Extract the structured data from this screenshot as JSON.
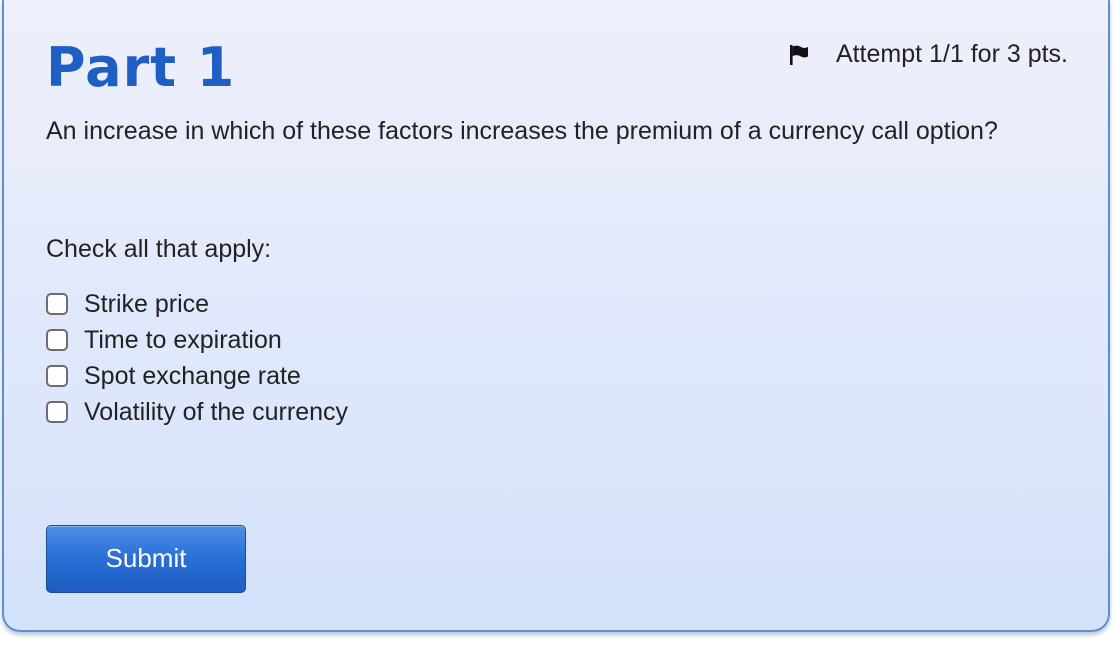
{
  "part": {
    "title": "Part 1"
  },
  "attempt": {
    "icon": "flag-icon",
    "text": "Attempt 1/1 for 3 pts."
  },
  "question": {
    "text": "An increase in which of these factors increases the premium of a currency call option?"
  },
  "instruction": "Check all that apply:",
  "options": [
    {
      "label": "Strike price",
      "checked": false
    },
    {
      "label": "Time to expiration",
      "checked": false
    },
    {
      "label": "Spot exchange rate",
      "checked": false
    },
    {
      "label": "Volatility of the currency",
      "checked": false
    }
  ],
  "submit": {
    "label": "Submit"
  },
  "colors": {
    "title": "#1f5fc4",
    "card_border": "#5b8fd0",
    "button": "#2a6ed6"
  }
}
